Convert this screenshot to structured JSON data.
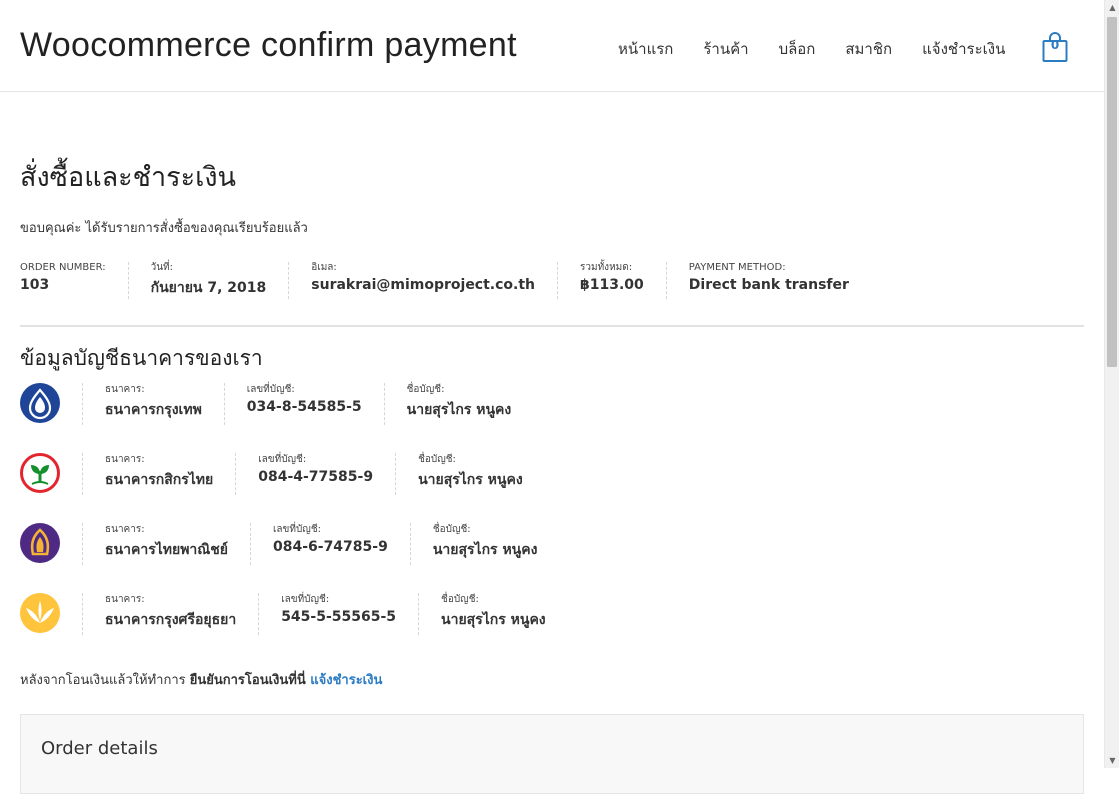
{
  "site": {
    "title": "Woocommerce confirm payment"
  },
  "nav": {
    "items": [
      {
        "label": "หน้าแรก"
      },
      {
        "label": "ร้านค้า"
      },
      {
        "label": "บล็อก"
      },
      {
        "label": "สมาชิก"
      },
      {
        "label": "แจ้งชำระเงิน"
      }
    ],
    "cart_count": "0"
  },
  "page": {
    "title": "สั่งซื้อและชำระเงิน",
    "thanks": "ขอบคุณค่ะ ได้รับรายการสั่งซื้อของคุณเรียบร้อยแล้ว"
  },
  "order_overview": [
    {
      "label": "ORDER NUMBER:",
      "value": "103"
    },
    {
      "label": "วันที่:",
      "value": "กันยายน 7, 2018"
    },
    {
      "label": "อิเมล:",
      "value": "surakrai@mimoproject.co.th"
    },
    {
      "label": "รวมทั้งหมด:",
      "value": "฿113.00"
    },
    {
      "label": "PAYMENT METHOD:",
      "value": "Direct bank transfer"
    }
  ],
  "bank_section": {
    "heading": "ข้อมูลบัญชีธนาคารของเรา",
    "field_labels": {
      "bank": "ธนาคาร:",
      "account_number": "เลขที่บัญชี:",
      "account_name": "ชื่อบัญชี:"
    },
    "banks": [
      {
        "logo": "bangkok-bank-logo",
        "color": "#1e4598",
        "bank": "ธนาคารกรุงเทพ",
        "account_number": "034-8-54585-5",
        "account_name": "นายสุรไกร หนูคง"
      },
      {
        "logo": "kasikorn-bank-logo",
        "color": "#138f2d",
        "bank": "ธนาคารกสิกรไทย",
        "account_number": "084-4-77585-9",
        "account_name": "นายสุรไกร หนูคง"
      },
      {
        "logo": "scb-bank-logo",
        "color": "#4e2a84",
        "bank": "ธนาคารไทยพาณิชย์",
        "account_number": "084-6-74785-9",
        "account_name": "นายสุรไกร หนูคง"
      },
      {
        "logo": "krungsri-bank-logo",
        "color": "#fec43b",
        "bank": "ธนาคารกรุงศรีอยุธยา",
        "account_number": "545-5-55565-5",
        "account_name": "นายสุรไกร หนูคง"
      }
    ]
  },
  "after_transfer": {
    "text": "หลังจากโอนเงินแล้วให้ทำการ ",
    "bold": "ยืนยันการโอนเงินที่นี่ ",
    "link": "แจ้งชำระเงิน"
  },
  "order_details": {
    "heading": "Order details"
  },
  "colors": {
    "link": "#2c7cc4",
    "divider": "#e2e2e2"
  }
}
